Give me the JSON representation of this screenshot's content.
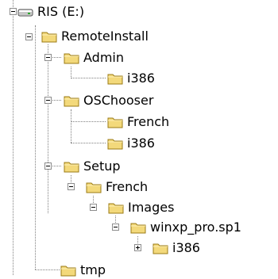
{
  "tree": {
    "drive": {
      "label": "RIS (E:)",
      "icon": "drive-icon",
      "children": [
        {
          "label": "RemoteInstall",
          "icon": "folder-icon",
          "children": [
            {
              "label": "Admin",
              "icon": "folder-icon",
              "children": [
                {
                  "label": "i386",
                  "icon": "folder-icon"
                }
              ]
            },
            {
              "label": "OSChooser",
              "icon": "folder-icon",
              "children": [
                {
                  "label": "French",
                  "icon": "folder-icon"
                },
                {
                  "label": "i386",
                  "icon": "folder-icon"
                }
              ]
            },
            {
              "label": "Setup",
              "icon": "folder-icon",
              "children": [
                {
                  "label": "French",
                  "icon": "folder-icon",
                  "children": [
                    {
                      "label": "Images",
                      "icon": "folder-icon",
                      "children": [
                        {
                          "label": "winxp_pro.sp1",
                          "icon": "folder-icon",
                          "children": [
                            {
                              "label": "i386",
                              "icon": "folder-icon",
                              "collapsed": true
                            }
                          ]
                        }
                      ]
                    }
                  ]
                }
              ]
            }
          ]
        },
        {
          "label": "tmp",
          "icon": "folder-icon"
        }
      ]
    }
  }
}
